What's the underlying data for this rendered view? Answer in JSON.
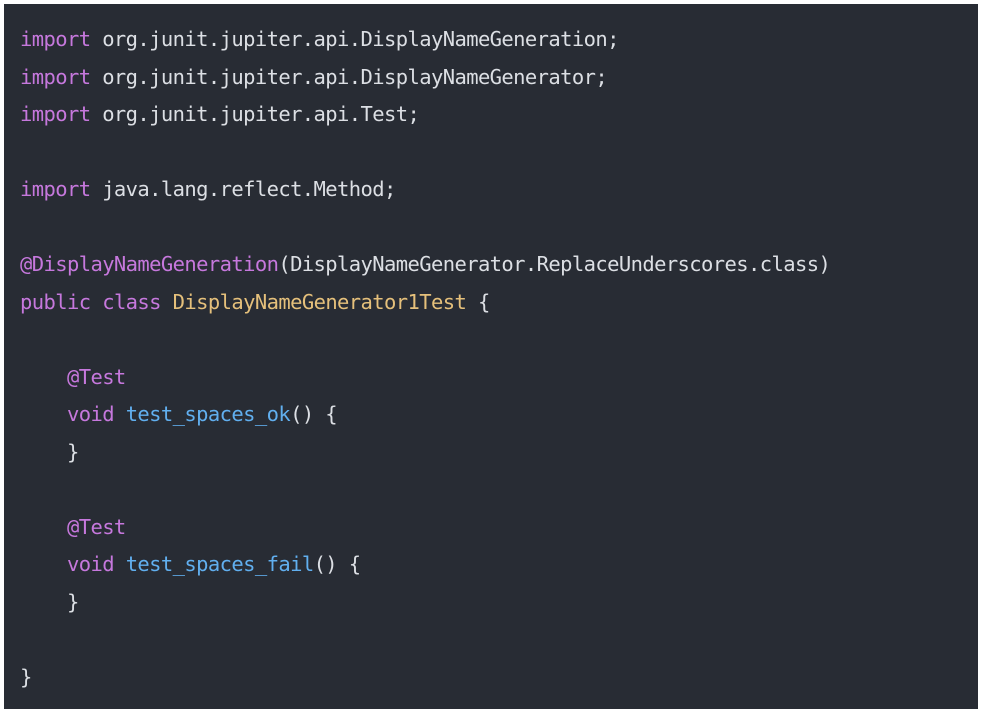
{
  "editor": {
    "theme_colors": {
      "background": "#282c34",
      "keyword": "#c678dd",
      "annotation": "#c678dd",
      "class_name": "#e5c07b",
      "function": "#61afef",
      "plain": "#dcdfe4"
    },
    "lines": [
      {
        "tokens": [
          {
            "t": "keyword",
            "v": "import"
          },
          {
            "t": "plain",
            "v": " org.junit.jupiter.api.DisplayNameGeneration;"
          }
        ]
      },
      {
        "tokens": [
          {
            "t": "keyword",
            "v": "import"
          },
          {
            "t": "plain",
            "v": " org.junit.jupiter.api.DisplayNameGenerator;"
          }
        ]
      },
      {
        "tokens": [
          {
            "t": "keyword",
            "v": "import"
          },
          {
            "t": "plain",
            "v": " org.junit.jupiter.api.Test;"
          }
        ]
      },
      {
        "tokens": []
      },
      {
        "tokens": [
          {
            "t": "keyword",
            "v": "import"
          },
          {
            "t": "plain",
            "v": " java.lang.reflect.Method;"
          }
        ]
      },
      {
        "tokens": []
      },
      {
        "tokens": [
          {
            "t": "annotation",
            "v": "@DisplayNameGeneration"
          },
          {
            "t": "plain",
            "v": "(DisplayNameGenerator.ReplaceUnderscores.class)"
          }
        ]
      },
      {
        "tokens": [
          {
            "t": "keyword",
            "v": "public"
          },
          {
            "t": "plain",
            "v": " "
          },
          {
            "t": "keyword",
            "v": "class"
          },
          {
            "t": "plain",
            "v": " "
          },
          {
            "t": "classname",
            "v": "DisplayNameGenerator1Test"
          },
          {
            "t": "plain",
            "v": " {"
          }
        ]
      },
      {
        "tokens": []
      },
      {
        "tokens": [
          {
            "t": "plain",
            "v": "    "
          },
          {
            "t": "annotation",
            "v": "@Test"
          }
        ]
      },
      {
        "tokens": [
          {
            "t": "plain",
            "v": "    "
          },
          {
            "t": "keyword",
            "v": "void"
          },
          {
            "t": "plain",
            "v": " "
          },
          {
            "t": "function",
            "v": "test_spaces_ok"
          },
          {
            "t": "plain",
            "v": "() {"
          }
        ]
      },
      {
        "tokens": [
          {
            "t": "plain",
            "v": "    }"
          }
        ]
      },
      {
        "tokens": []
      },
      {
        "tokens": [
          {
            "t": "plain",
            "v": "    "
          },
          {
            "t": "annotation",
            "v": "@Test"
          }
        ]
      },
      {
        "tokens": [
          {
            "t": "plain",
            "v": "    "
          },
          {
            "t": "keyword",
            "v": "void"
          },
          {
            "t": "plain",
            "v": " "
          },
          {
            "t": "function",
            "v": "test_spaces_fail"
          },
          {
            "t": "plain",
            "v": "() {"
          }
        ]
      },
      {
        "tokens": [
          {
            "t": "plain",
            "v": "    }"
          }
        ]
      },
      {
        "tokens": []
      },
      {
        "tokens": [
          {
            "t": "plain",
            "v": "}"
          }
        ]
      }
    ]
  }
}
